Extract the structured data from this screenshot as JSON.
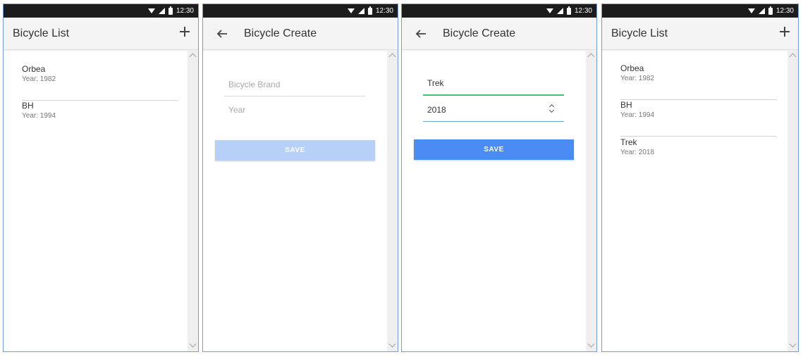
{
  "status_bar": {
    "time": "12:30"
  },
  "screens": {
    "list_before": {
      "title": "Bicycle List",
      "items": [
        {
          "name": "Orbea",
          "year": "Year: 1982"
        },
        {
          "name": "BH",
          "year": "Year: 1994"
        }
      ]
    },
    "create_empty": {
      "title": "Bicycle Create",
      "brand_placeholder": "Bicycle Brand",
      "year_placeholder": "Year",
      "brand_value": "",
      "year_value": "",
      "save_label": "SAVE"
    },
    "create_filled": {
      "title": "Bicycle Create",
      "brand_value": "Trek",
      "year_value": "2018",
      "save_label": "SAVE"
    },
    "list_after": {
      "title": "Bicycle List",
      "items": [
        {
          "name": "Orbea",
          "year": "Year: 1982"
        },
        {
          "name": "BH",
          "year": "Year: 1994"
        },
        {
          "name": "Trek",
          "year": "Year: 2018"
        }
      ]
    }
  },
  "colors": {
    "accent_blue": "#4a8bf4",
    "disabled_blue": "#b7d0f7",
    "focus_green": "#3cc46a",
    "status_bar": "#1c1c1c",
    "toolbar": "#f4f4f4"
  },
  "icons": [
    "wifi-icon",
    "signal-icon",
    "battery-icon",
    "add-icon",
    "back-arrow-icon"
  ]
}
